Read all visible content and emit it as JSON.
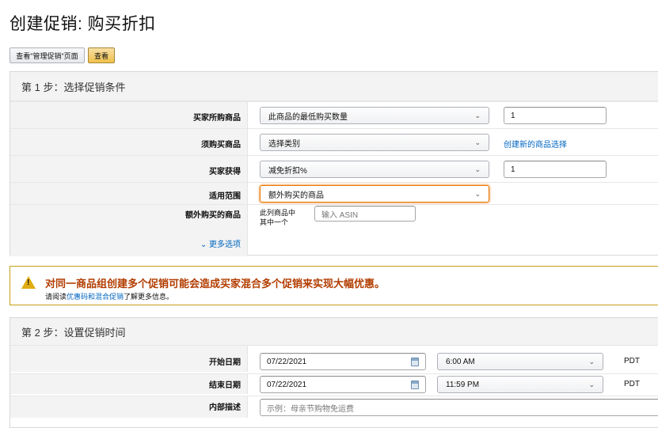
{
  "page": {
    "title": "创建促销: 购买折扣"
  },
  "toolbar": {
    "view_manage_label": "查看\"管理促销\"页面",
    "view_label": "查看"
  },
  "step1": {
    "header": "第 1 步：选择促销条件",
    "rows": {
      "buyer_purchases": {
        "label": "买家所购商品",
        "select": "此商品的最低购买数量",
        "input_value": "1"
      },
      "purchased_items": {
        "label": "须购买商品",
        "select": "选择类别",
        "link": "创建新的商品选择"
      },
      "buyer_gets": {
        "label": "买家获得",
        "select": "减免折扣%",
        "input_value": "1"
      },
      "applies_to": {
        "label": "适用范围",
        "select": "额外购买的商品"
      },
      "additional_items": {
        "label": "额外购买的商品",
        "desc_line1": "此列商品中",
        "desc_line2": "其中一个",
        "asin_placeholder": "输入 ASIN"
      }
    },
    "more_options": "更多选项"
  },
  "alert": {
    "title": "对同一商品组创建多个促销可能会造成买家混合多个促销来实现大幅优惠。",
    "body_prefix": "请阅读",
    "body_link": "优惠码和混合促销",
    "body_suffix": "了解更多信息。",
    "icon_mark": "!",
    "icon": "warning-icon"
  },
  "step2": {
    "header": "第 2 步：设置促销时间",
    "rows": {
      "start": {
        "label": "开始日期",
        "date": "07/22/2021",
        "time": "6:00 AM",
        "tz": "PDT"
      },
      "end": {
        "label": "结束日期",
        "date": "07/22/2021",
        "time": "11:59 PM",
        "tz": "PDT"
      },
      "internal_desc": {
        "label": "内部描述",
        "placeholder": "示例：母亲节购物免运费"
      }
    }
  },
  "colors": {
    "link": "#0066c0",
    "alert_title": "#b23c00",
    "primary_button": "#f0c14b",
    "alert_border": "#c59f18"
  }
}
